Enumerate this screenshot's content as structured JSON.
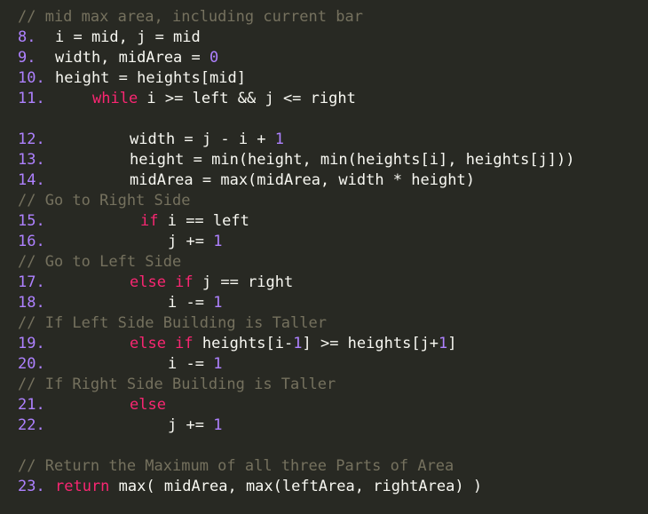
{
  "code": {
    "lines": [
      {
        "kind": "comment",
        "text": "// mid max area, including current bar"
      },
      {
        "kind": "code",
        "num": "8.",
        "indent": 62,
        "parts": [
          {
            "t": "i = mid, j = mid"
          }
        ]
      },
      {
        "kind": "code",
        "num": "9.",
        "indent": 62,
        "parts": [
          {
            "t": "width, midArea = "
          },
          {
            "t": "0",
            "c": "lit"
          }
        ]
      },
      {
        "kind": "code",
        "num": "10.",
        "indent": 62,
        "parts": [
          {
            "t": "height = heights[mid]"
          }
        ]
      },
      {
        "kind": "code",
        "num": "11.",
        "indent": 104,
        "parts": [
          {
            "t": "while",
            "c": "kw"
          },
          {
            "t": " i >= left && j <= right"
          }
        ]
      },
      {
        "kind": "blank"
      },
      {
        "kind": "code",
        "num": "12.",
        "indent": 146,
        "parts": [
          {
            "t": "width = j - i + "
          },
          {
            "t": "1",
            "c": "lit"
          }
        ]
      },
      {
        "kind": "code",
        "num": "13.",
        "indent": 146,
        "parts": [
          {
            "t": "height = min(height, min(heights[i], heights[j]))"
          }
        ]
      },
      {
        "kind": "code",
        "num": "14.",
        "indent": 146,
        "parts": [
          {
            "t": "midArea = max(midArea, width * height)"
          }
        ]
      },
      {
        "kind": "comment",
        "text": "// Go to Right Side"
      },
      {
        "kind": "code",
        "num": "15.",
        "indent": 158,
        "parts": [
          {
            "t": "if",
            "c": "kw"
          },
          {
            "t": " i == left"
          }
        ]
      },
      {
        "kind": "code",
        "num": "16.",
        "indent": 189,
        "parts": [
          {
            "t": "j += "
          },
          {
            "t": "1",
            "c": "lit"
          }
        ]
      },
      {
        "kind": "comment",
        "text": "// Go to Left Side"
      },
      {
        "kind": "code",
        "num": "17.",
        "indent": 146,
        "parts": [
          {
            "t": "else if",
            "c": "kw"
          },
          {
            "t": " j == right"
          }
        ]
      },
      {
        "kind": "code",
        "num": "18.",
        "indent": 189,
        "parts": [
          {
            "t": "i -= "
          },
          {
            "t": "1",
            "c": "lit"
          }
        ]
      },
      {
        "kind": "comment",
        "text": "// If Left Side Building is Taller"
      },
      {
        "kind": "code",
        "num": "19.",
        "indent": 146,
        "parts": [
          {
            "t": "else if",
            "c": "kw"
          },
          {
            "t": " heights[i-"
          },
          {
            "t": "1",
            "c": "lit"
          },
          {
            "t": "] >= heights[j+"
          },
          {
            "t": "1",
            "c": "lit"
          },
          {
            "t": "]"
          }
        ]
      },
      {
        "kind": "code",
        "num": "20.",
        "indent": 189,
        "parts": [
          {
            "t": "i -= "
          },
          {
            "t": "1",
            "c": "lit"
          }
        ]
      },
      {
        "kind": "comment",
        "text": "// If Right Side Building is Taller"
      },
      {
        "kind": "code",
        "num": "21.",
        "indent": 146,
        "parts": [
          {
            "t": "else",
            "c": "kw"
          }
        ]
      },
      {
        "kind": "code",
        "num": "22.",
        "indent": 189,
        "parts": [
          {
            "t": "j += "
          },
          {
            "t": "1",
            "c": "lit"
          }
        ]
      },
      {
        "kind": "blank"
      },
      {
        "kind": "comment",
        "text": "// Return the Maximum of all three Parts of Area"
      },
      {
        "kind": "code",
        "num": "23.",
        "indent": 62,
        "parts": [
          {
            "t": "return",
            "c": "kw"
          },
          {
            "t": " max( midArea, max(leftArea, rightArea) )"
          }
        ]
      }
    ]
  },
  "colors": {
    "background": "#282923",
    "text": "#f8f8f2",
    "line_number": "#ae81ff",
    "keyword": "#f92672",
    "number": "#ae81ff",
    "comment": "#75715e"
  }
}
